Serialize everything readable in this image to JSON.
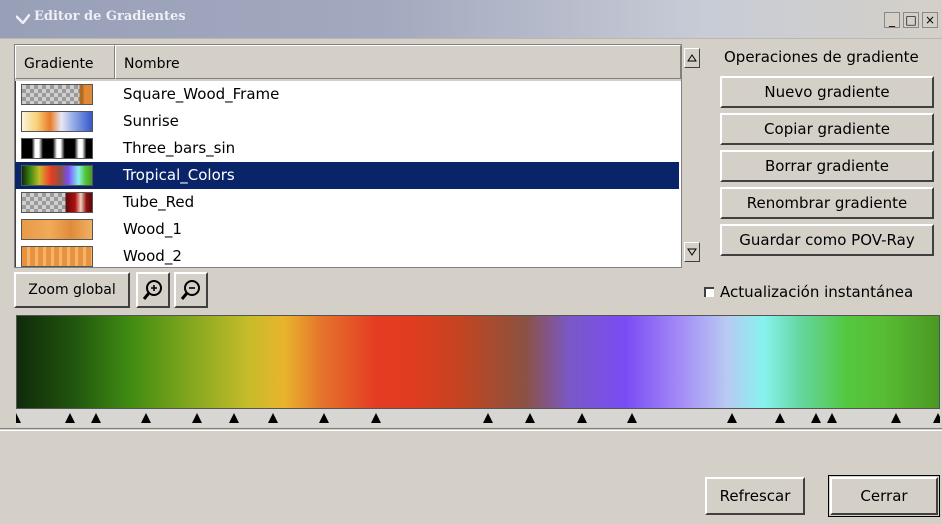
{
  "window": {
    "title": "Editor de Gradientes",
    "controls": [
      "_",
      "□",
      "×"
    ]
  },
  "list": {
    "col_gradient": "Gradiente",
    "col_name": "Nombre",
    "rows": [
      {
        "name": "Square_Wood_Frame",
        "selected": false
      },
      {
        "name": "Sunrise",
        "selected": false
      },
      {
        "name": "Three_bars_sin",
        "selected": false
      },
      {
        "name": "Tropical_Colors",
        "selected": true
      },
      {
        "name": "Tube_Red",
        "selected": false
      },
      {
        "name": "Wood_1",
        "selected": false
      },
      {
        "name": "Wood_2",
        "selected": false
      }
    ]
  },
  "operations": {
    "group_title": "Operaciones de gradiente",
    "new": "Nuevo gradiente",
    "copy": "Copiar gradiente",
    "delete": "Borrar gradiente",
    "rename": "Renombrar gradiente",
    "save_pov": "Guardar como POV-Ray"
  },
  "toolbar": {
    "zoom_all": "Zoom global",
    "zoom_in_icon": "zoom-in-icon",
    "zoom_out_icon": "zoom-out-icon"
  },
  "instant_update": {
    "label": "Actualización instantánea",
    "checked": false
  },
  "footer": {
    "refresh": "Refrescar",
    "close": "Cerrar"
  },
  "colors": {
    "selection": "#0a246a",
    "face": "#d4d0c8",
    "title_gradient_start": "#98a0b8"
  }
}
